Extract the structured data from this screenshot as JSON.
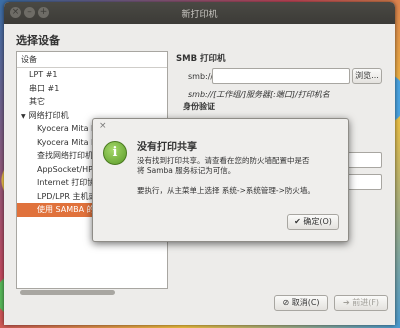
{
  "window": {
    "title": "新打印机"
  },
  "heading": "选择设备",
  "device_list": {
    "header": "设备",
    "items": [
      {
        "label": "LPT #1",
        "indent": 1
      },
      {
        "label": "串口 #1",
        "indent": 1
      },
      {
        "label": "其它",
        "indent": 1
      },
      {
        "label": "网络打印机",
        "indent": 0,
        "expander": "▼"
      },
      {
        "label": "Kyocera Mita KM",
        "indent": 2
      },
      {
        "label": "Kyocera Mita KM",
        "indent": 2
      },
      {
        "label": "查找网络打印机",
        "indent": 2
      },
      {
        "label": "AppSocket/HP Je",
        "indent": 2
      },
      {
        "label": "Internet 打印协议",
        "indent": 2
      },
      {
        "label": "LPD/LPR 主机或打",
        "indent": 2
      },
      {
        "label": "使用 SAMBA 的",
        "indent": 2,
        "selected": true
      }
    ]
  },
  "smb": {
    "title": "SMB 打印机",
    "prefix": "smb://",
    "value": "",
    "browse_label": "浏览...",
    "hint": "smb://[工作组/]服务器[:端口]/打印机名",
    "auth_title": "身份验证"
  },
  "dialog": {
    "close_glyph": "×",
    "icon_glyph": "i",
    "title": "没有打印共享",
    "line1": "没有找到打印共享。请查看在您的防火墙配置中是否",
    "line2": "将 Samba 服务标记为可信。",
    "line3": "要执行，从主菜单上选择 系统->系统管理->防火墙。",
    "ok_label": "✔ 确定(O)"
  },
  "footer": {
    "cancel_label": "⊘ 取消(C)",
    "forward_label": "➔ 前进(F)"
  },
  "colors": {
    "selection": "#e0723c",
    "titlebar": "#3c3b37"
  }
}
